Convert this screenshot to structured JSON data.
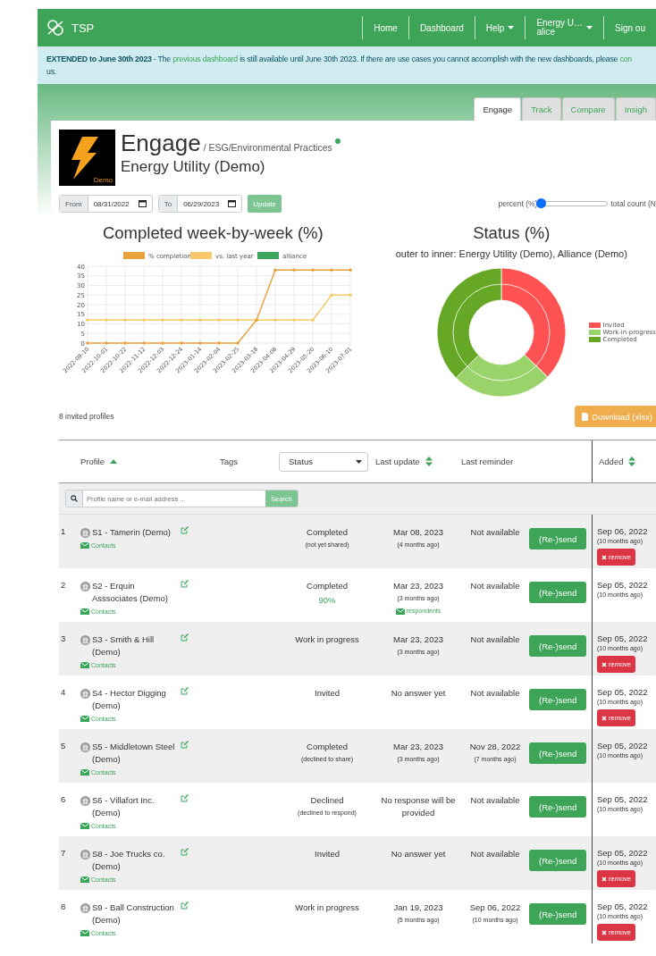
{
  "header": {
    "brand": "TSP",
    "nav": [
      {
        "label": "Home",
        "kind": "link"
      },
      {
        "label": "Dashboard",
        "kind": "link"
      },
      {
        "label": "Help",
        "kind": "dropdown"
      },
      {
        "label": "Energy U…",
        "sublabel": "alice",
        "kind": "dropdown"
      },
      {
        "label": "Sign ou",
        "kind": "link"
      }
    ]
  },
  "banner": {
    "bold": "EXTENDED to June 30th 2023",
    "text_1": " - The ",
    "link": "previous dashboard",
    "text_2": " is still available until June 30th 2023. If there are use cases you cannot accomplish with the new dashboards, please ",
    "link_2": "con",
    "text_3": "us."
  },
  "tabs": [
    {
      "label": "Engage",
      "selected": true
    },
    {
      "label": "Track",
      "selected": false
    },
    {
      "label": "Compare",
      "selected": false
    },
    {
      "label": "Insigh",
      "selected": false
    }
  ],
  "page": {
    "logo_text": "Demo",
    "title": "Engage",
    "breadcrumb": "/ ESG/Environmental Practices",
    "subtitle": "Energy Utility (Demo)"
  },
  "filters": {
    "from_label": "From",
    "from_value": "08/31/2022",
    "to_label": "To",
    "to_value": "06/29/2023",
    "update_button": "Update"
  },
  "toggle": {
    "left_label": "percent (%)",
    "right_label": "total count (N",
    "level": 0
  },
  "line_chart": {
    "title": "Completed week-by-week (%)",
    "chart_data": {
      "type": "line",
      "categories": [
        "2022-09-10",
        "2022-10-01",
        "2022-10-22",
        "2022-11-12",
        "2022-12-03",
        "2022-12-24",
        "2023-01-14",
        "2023-02-04",
        "2023-02-25",
        "2023-03-18",
        "2023-04-08",
        "2023-04-29",
        "2023-05-20",
        "2023-06-10",
        "2023-07-01"
      ],
      "series": [
        {
          "name": "% completion",
          "color": "#e8a33d",
          "values": [
            0,
            0,
            0,
            0,
            0,
            0,
            0,
            0,
            0,
            12,
            38,
            38,
            38,
            38,
            38
          ]
        },
        {
          "name": "vs. last year",
          "color": "#f7c96b",
          "values": [
            12,
            12,
            12,
            12,
            12,
            12,
            12,
            12,
            12,
            12,
            12,
            12,
            12,
            25,
            25
          ]
        },
        {
          "name": "alliance",
          "color": "#3ba55c",
          "values": [
            null,
            null,
            null,
            null,
            null,
            null,
            null,
            null,
            null,
            null,
            null,
            null,
            null,
            null,
            null
          ]
        }
      ],
      "ylim": [
        0,
        40
      ],
      "yticks": [
        0,
        5,
        10,
        15,
        20,
        25,
        30,
        35,
        40
      ],
      "grid": true,
      "legend": true
    }
  },
  "status_chart": {
    "title": "Status (%)",
    "subtitle": "outer to inner: Energy Utility (Demo), Alliance (Demo)",
    "legend": [
      {
        "label": "Invited",
        "color": "#ff5252"
      },
      {
        "label": "Work-in-progress",
        "color": "#99d36a"
      },
      {
        "label": "Completed",
        "color": "#66a825"
      }
    ]
  },
  "profiles_count": "8 invited profiles",
  "download_button": "Download (xlsx)",
  "table": {
    "columns": [
      {
        "label": "Profile",
        "kind": "sorted"
      },
      {
        "label": "Tags",
        "kind": "plain"
      },
      {
        "label": "Status",
        "kind": "select"
      },
      {
        "label": "Last update",
        "kind": "sortable"
      },
      {
        "label": "Last reminder",
        "kind": "plain"
      },
      {
        "label": "Added",
        "kind": "sortable"
      }
    ],
    "search": {
      "placeholder": "Profile name or e-mail address ...",
      "button": "Search"
    },
    "rows": [
      {
        "number": "1",
        "name": "S1 - Tamerin (Demo)",
        "contacts": "Contacts",
        "status": "Completed",
        "status_detail": {
          "text": "(not yet shared)",
          "kind": "note"
        },
        "last_update": "Mar 08, 2023",
        "last_update_ago": "(4 months ago)",
        "reminder": "Not available",
        "resend": "(Re-)send",
        "added": "Sep 06, 2022",
        "added_ago": "(10 months ago)",
        "remove": "remove"
      },
      {
        "number": "2",
        "name": "S2 - Erquin Asssociates (Demo)",
        "contacts": "Contacts",
        "status": "Completed",
        "status_detail": {
          "text": "90%",
          "kind": "percent"
        },
        "last_update": "Mar 23, 2023",
        "last_update_ago": "(3 months ago)",
        "respondents": "respondents",
        "reminder": "Not available",
        "resend": "(Re-)send",
        "added": "Sep 05, 2022",
        "added_ago": "(10 months ago)"
      },
      {
        "number": "3",
        "name": "S3 - Smith & Hill (Demo)",
        "contacts": "Contacts",
        "status": "Work in progress",
        "last_update": "Mar 23, 2023",
        "last_update_ago": "(3 months ago)",
        "reminder": "Not available",
        "resend": "(Re-)send",
        "added": "Sep 05, 2022",
        "added_ago": "(10 months ago)",
        "remove": "remove"
      },
      {
        "number": "4",
        "name": "S4 - Hector Digging (Demo)",
        "contacts": "Contacts",
        "status": "Invited",
        "last_update": "No answer yet",
        "reminder": "Not available",
        "resend": "(Re-)send",
        "added": "Sep 05, 2022",
        "added_ago": "(10 months ago)",
        "remove": "remove"
      },
      {
        "number": "5",
        "name": "S5 - Middletown Steel (Demo)",
        "contacts": "Contacts",
        "status": "Completed",
        "status_detail": {
          "text": "(declined to share)",
          "kind": "note"
        },
        "last_update": "Mar 23, 2023",
        "last_update_ago": "(3 months ago)",
        "reminder": "Nov 28, 2022",
        "reminder_ago": "(7 months ago)",
        "resend": "(Re-)send",
        "added": "Sep 05, 2022",
        "added_ago": "(10 months ago)"
      },
      {
        "number": "6",
        "name": "S6 - Villafort Inc. (Demo)",
        "contacts": "Contacts",
        "status": "Declined",
        "status_detail": {
          "text": "(declined to respond)",
          "kind": "note"
        },
        "last_update": "No response will be provided",
        "reminder": "Not available",
        "resend": "(Re-)send",
        "added": "Sep 05, 2022",
        "added_ago": "(10 months ago)"
      },
      {
        "number": "7",
        "name": "S8 - Joe Trucks co. (Demo)",
        "contacts": "Contacts",
        "status": "Invited",
        "last_update": "No answer yet",
        "reminder": "Not available",
        "resend": "(Re-)send",
        "added": "Sep 05, 2022",
        "added_ago": "(10 months ago)",
        "remove": "remove"
      },
      {
        "number": "8",
        "name": "S9 - Ball Construction (Demo)",
        "contacts": "Contacts",
        "status": "Work in progress",
        "last_update": "Jan 19, 2023",
        "last_update_ago": "(5 months ago)",
        "reminder": "Sep 06, 2022",
        "reminder_ago": "(10 months ago)",
        "resend": "(Re-)send",
        "added": "Sep 05, 2022",
        "added_ago": "(10 months ago)",
        "remove": "remove"
      }
    ]
  }
}
